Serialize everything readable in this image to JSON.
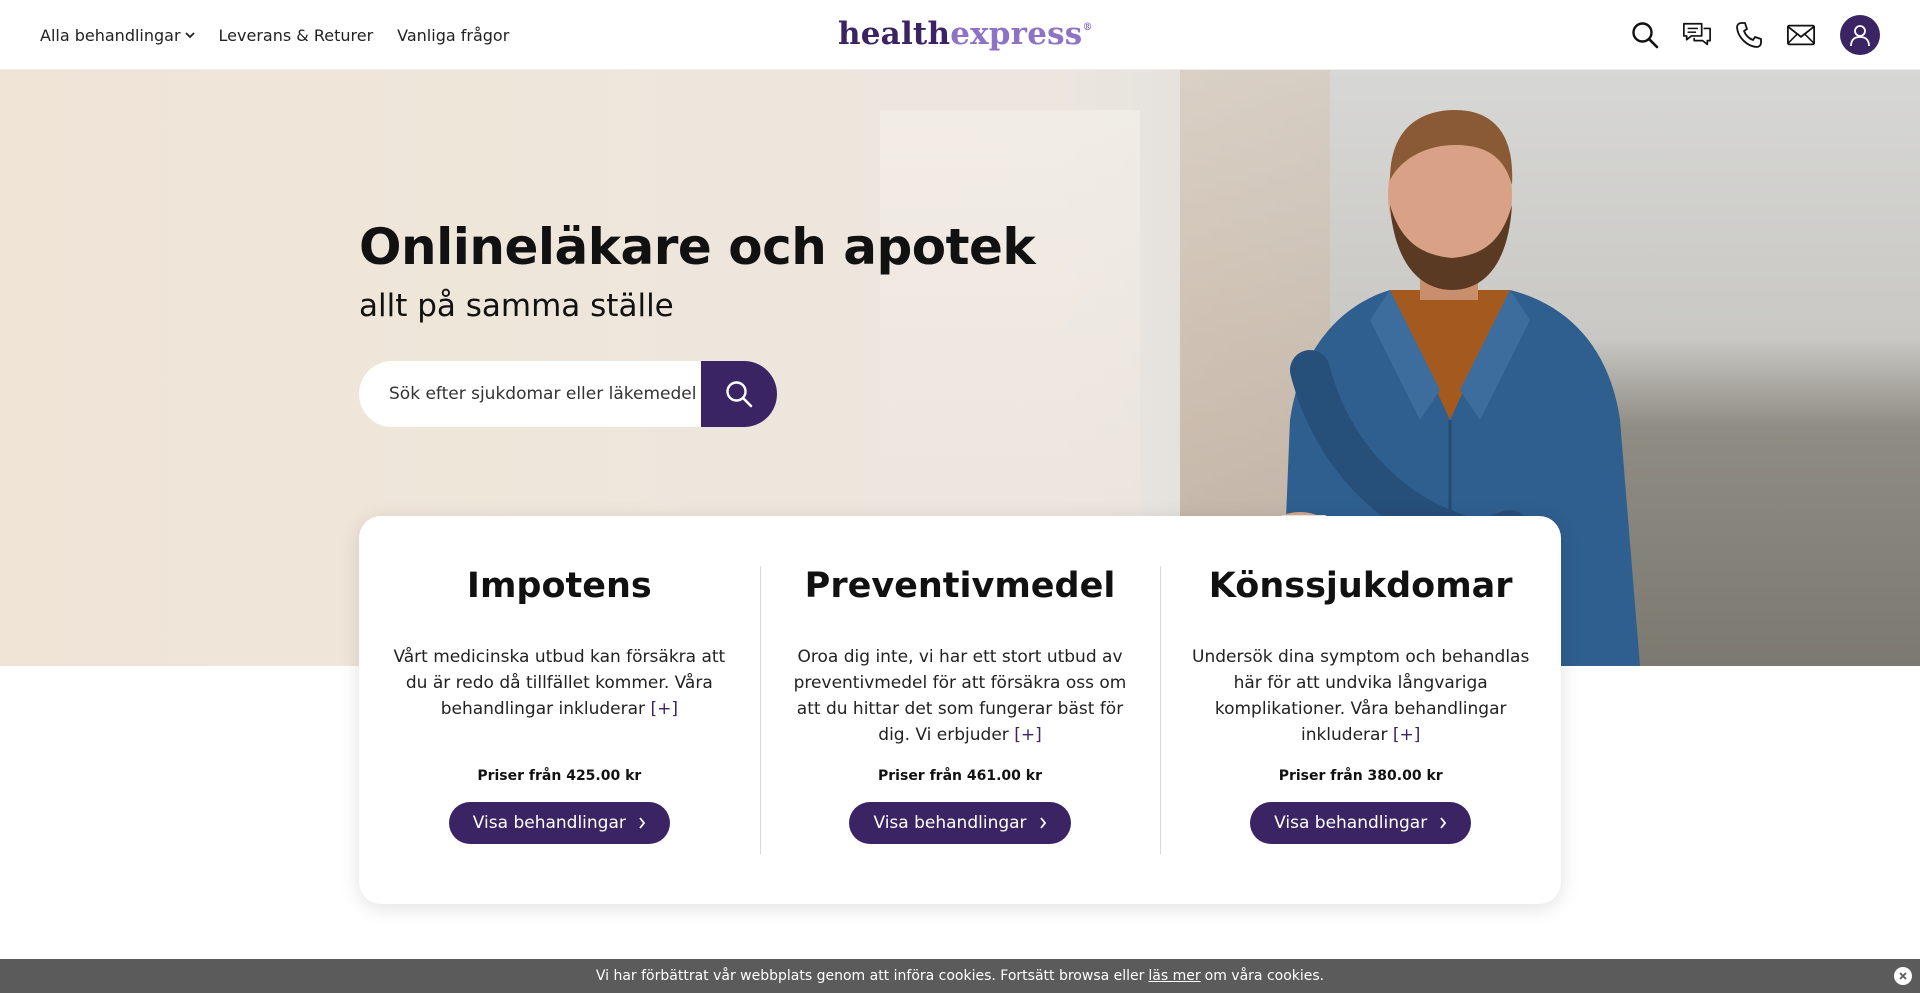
{
  "nav": {
    "all_treatments": "Alla behandlingar",
    "delivery": "Leverans & Returer",
    "faq": "Vanliga frågor"
  },
  "logo": {
    "part1": "health",
    "part2": "express",
    "reg": "®"
  },
  "header_icons": [
    "search-icon",
    "chat-icon",
    "phone-icon",
    "mail-icon",
    "user-icon"
  ],
  "hero": {
    "title": "Onlineläkare och apotek",
    "subtitle": "allt på samma ställe",
    "search_placeholder": "Sök efter sjukdomar eller läkemedel"
  },
  "cards": [
    {
      "title": "Impotens",
      "text": "Vårt medicinska utbud kan försäkra att du är redo då tillfället kommer. Våra behandlingar inkluderar",
      "more": "[+]",
      "price": "Priser från 425.00 kr",
      "button": "Visa behandlingar"
    },
    {
      "title": "Preventivmedel",
      "text": "Oroa dig inte, vi har ett stort utbud av preventivmedel för att försäkra oss om att du hittar det som fungerar bäst för dig. Vi erbjuder",
      "more": "[+]",
      "price": "Priser från 461.00 kr",
      "button": "Visa behandlingar"
    },
    {
      "title": "Könssjukdomar",
      "text": "Undersök dina symptom och behandlas här för att undvika långvariga komplikationer. Våra behandlingar inkluderar",
      "more": "[+]",
      "price": "Priser från 380.00 kr",
      "button": "Visa behandlingar"
    }
  ],
  "cookie": {
    "text_before": "Vi har förbättrat vår webbplats genom att införa cookies. Fortsätt browsa eller",
    "link": "läs mer",
    "text_after": "om våra cookies."
  },
  "colors": {
    "brand": "#3b2464",
    "brand_light": "#8e73c4",
    "cookie_bar": "#5b5b5b"
  }
}
